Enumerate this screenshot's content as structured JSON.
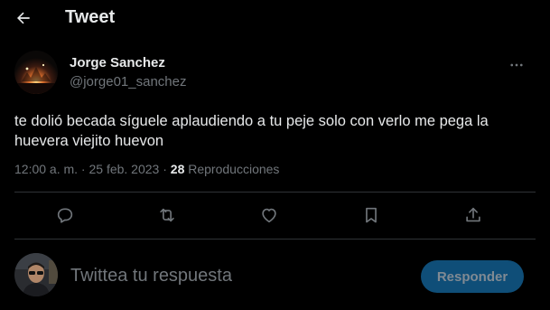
{
  "header": {
    "title": "Tweet",
    "back_icon": "arrow-left-icon"
  },
  "tweet": {
    "author_name": "Jorge Sanchez",
    "author_handle": "@jorge01_sanchez",
    "text": "te dolió becada síguele  aplaudiendo a tu peje solo con verlo me pega la huevera viejito huevon",
    "timestamp": "12:00 a. m. · 25 feb. 2023 · ",
    "views_count": "28",
    "views_label": " Reproducciones"
  },
  "actions": [
    {
      "name": "reply",
      "icon": "comment-icon"
    },
    {
      "name": "retweet",
      "icon": "retweet-icon"
    },
    {
      "name": "like",
      "icon": "heart-icon"
    },
    {
      "name": "bookmark",
      "icon": "bookmark-icon"
    },
    {
      "name": "share",
      "icon": "share-icon"
    }
  ],
  "reply": {
    "placeholder": "Twittea tu respuesta",
    "button_label": "Responder"
  },
  "colors": {
    "background": "#000000",
    "text_primary": "#e7e9ea",
    "text_secondary": "#71767b",
    "divider": "#2f3336",
    "reply_button_disabled": "#0f4e78"
  }
}
